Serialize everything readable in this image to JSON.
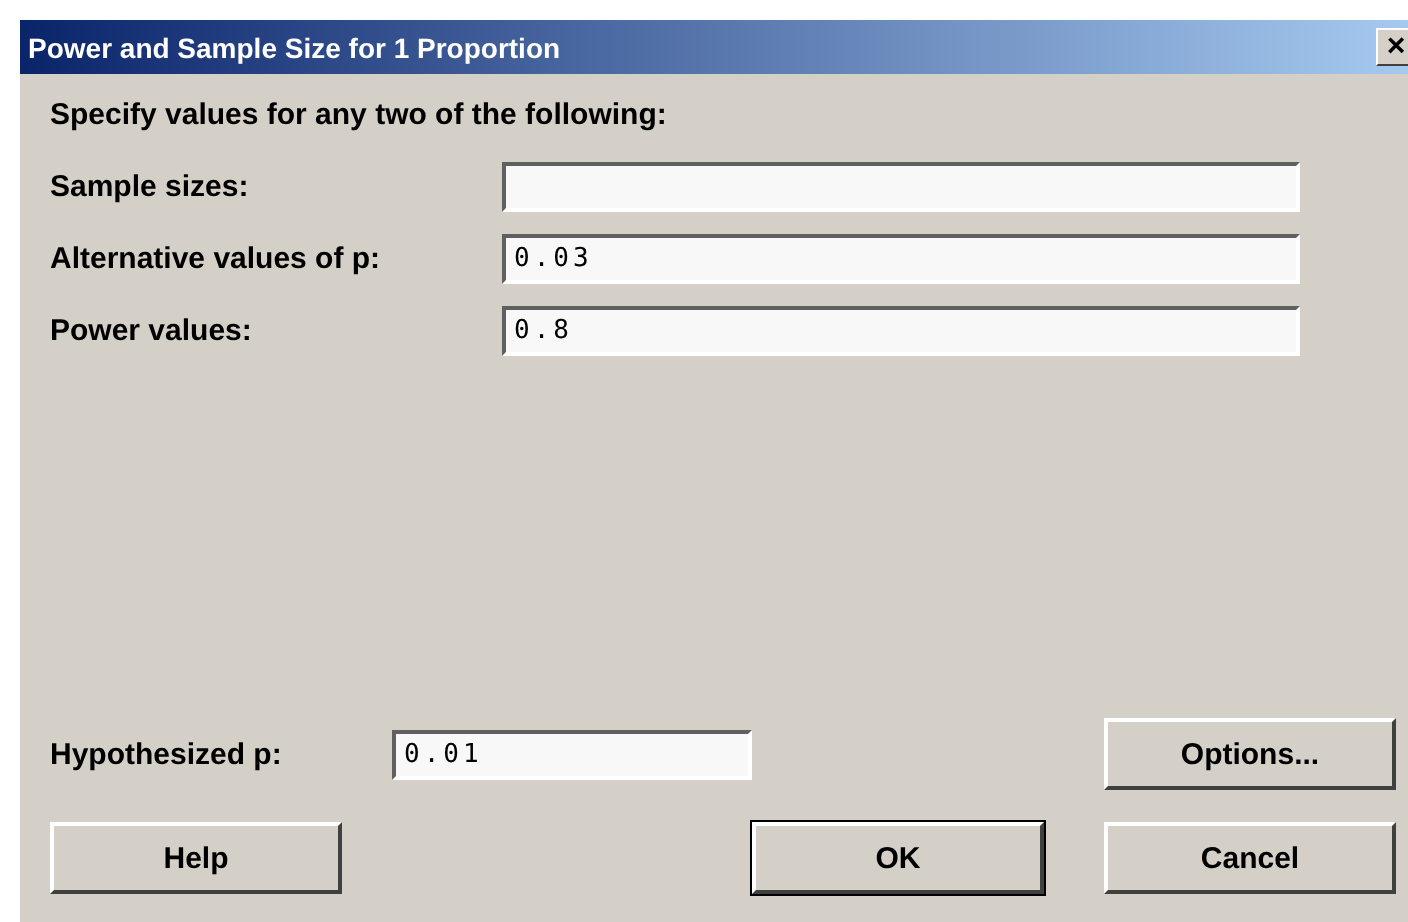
{
  "window": {
    "title": "Power and Sample Size for 1 Proportion",
    "close": "×"
  },
  "instruction": "Specify values for any two of the following:",
  "fields": [
    {
      "label": "Sample sizes:"
    },
    {
      "label": "Alternative values of p:",
      "value": "0.03"
    },
    {
      "label": "Power values:",
      "value": "0.8"
    }
  ],
  "hypothesized": {
    "label": "Hypothesized p:",
    "value": "0.01"
  },
  "options_button": "Options...",
  "buttons": [
    {
      "label": "Help",
      "default": false
    },
    {
      "label": "OK",
      "default": true
    },
    {
      "label": "Cancel",
      "default": false
    }
  ]
}
